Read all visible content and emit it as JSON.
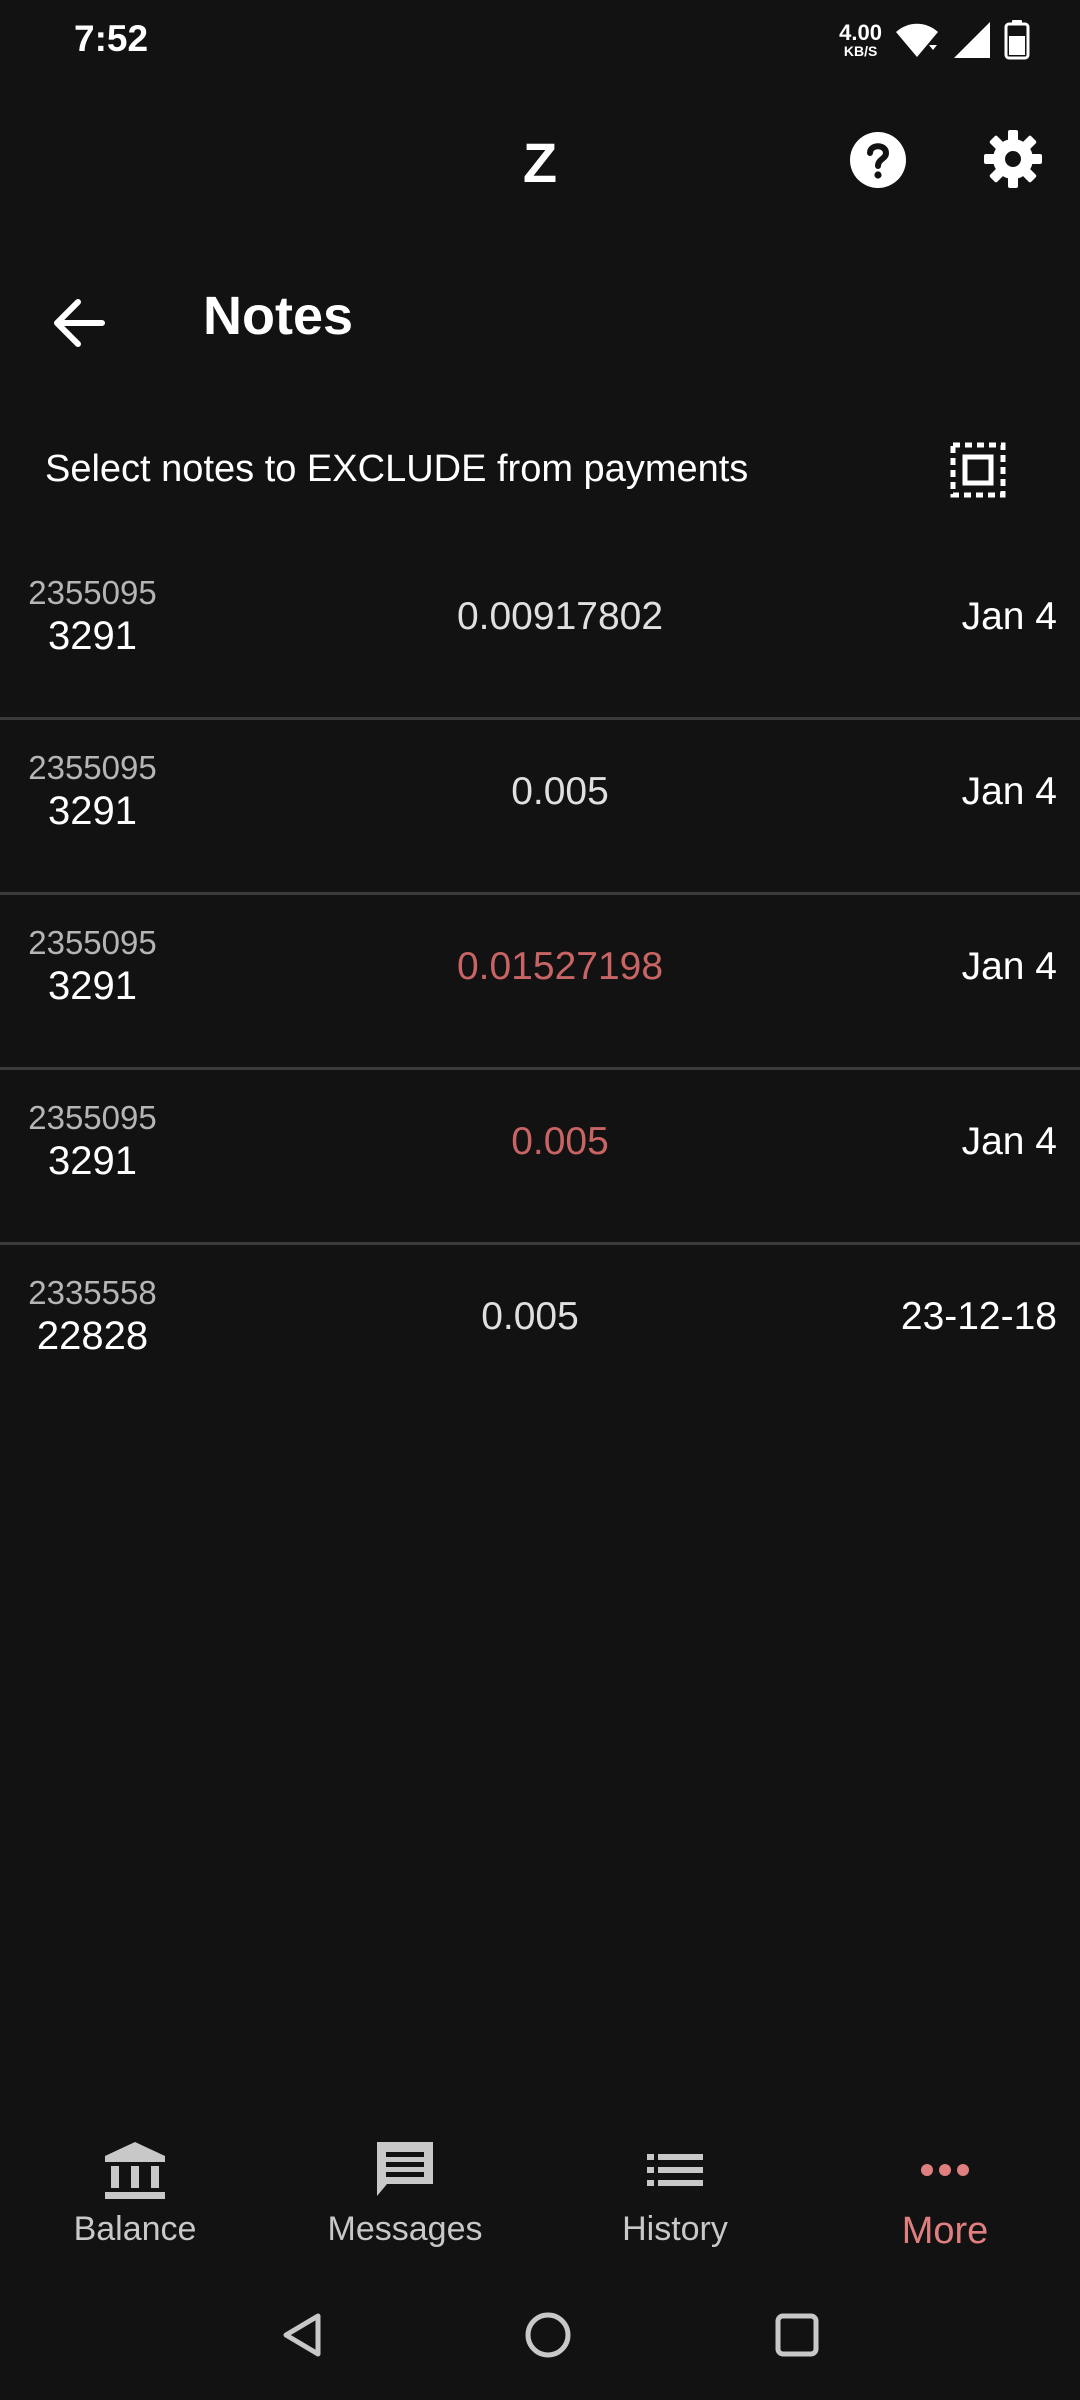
{
  "status_bar": {
    "time": "7:52",
    "net_speed_value": "4.00",
    "net_speed_unit": "KB/S"
  },
  "app_bar": {
    "title": "Z",
    "help_icon": "help-circle-icon",
    "settings_icon": "gear-icon"
  },
  "header": {
    "back_icon": "arrow-left-icon",
    "title": "Notes"
  },
  "instruction": {
    "text": "Select notes to EXCLUDE from payments",
    "select_all_icon": "select-all-icon"
  },
  "colors": {
    "background": "#121212",
    "normal_value": "#e0e0e0",
    "excluded_value": "#c86464",
    "active_nav": "#e07f7f",
    "divider": "#3a3a3a"
  },
  "notes": [
    {
      "height_top": "2355095",
      "height_bottom": "3291",
      "value": "0.00917802",
      "date": "Jan 4",
      "excluded": false
    },
    {
      "height_top": "2355095",
      "height_bottom": "3291",
      "value": "0.005",
      "date": "Jan 4",
      "excluded": false
    },
    {
      "height_top": "2355095",
      "height_bottom": "3291",
      "value": "0.01527198",
      "date": "Jan 4",
      "excluded": true
    },
    {
      "height_top": "2355095",
      "height_bottom": "3291",
      "value": "0.005",
      "date": "Jan 4",
      "excluded": true
    },
    {
      "height_top": "2335558",
      "height_bottom": "22828",
      "value": "0.005",
      "date": "23-12-18",
      "excluded": false
    }
  ],
  "bottom_nav": {
    "items": [
      {
        "label": "Balance",
        "icon": "bank-icon",
        "active": false
      },
      {
        "label": "Messages",
        "icon": "message-icon",
        "active": false
      },
      {
        "label": "History",
        "icon": "list-icon",
        "active": false
      },
      {
        "label": "More",
        "icon": "more-horizontal-icon",
        "active": true
      }
    ]
  },
  "system_nav": {
    "back_icon": "triangle-back-icon",
    "home_icon": "circle-home-icon",
    "recents_icon": "square-recents-icon"
  }
}
